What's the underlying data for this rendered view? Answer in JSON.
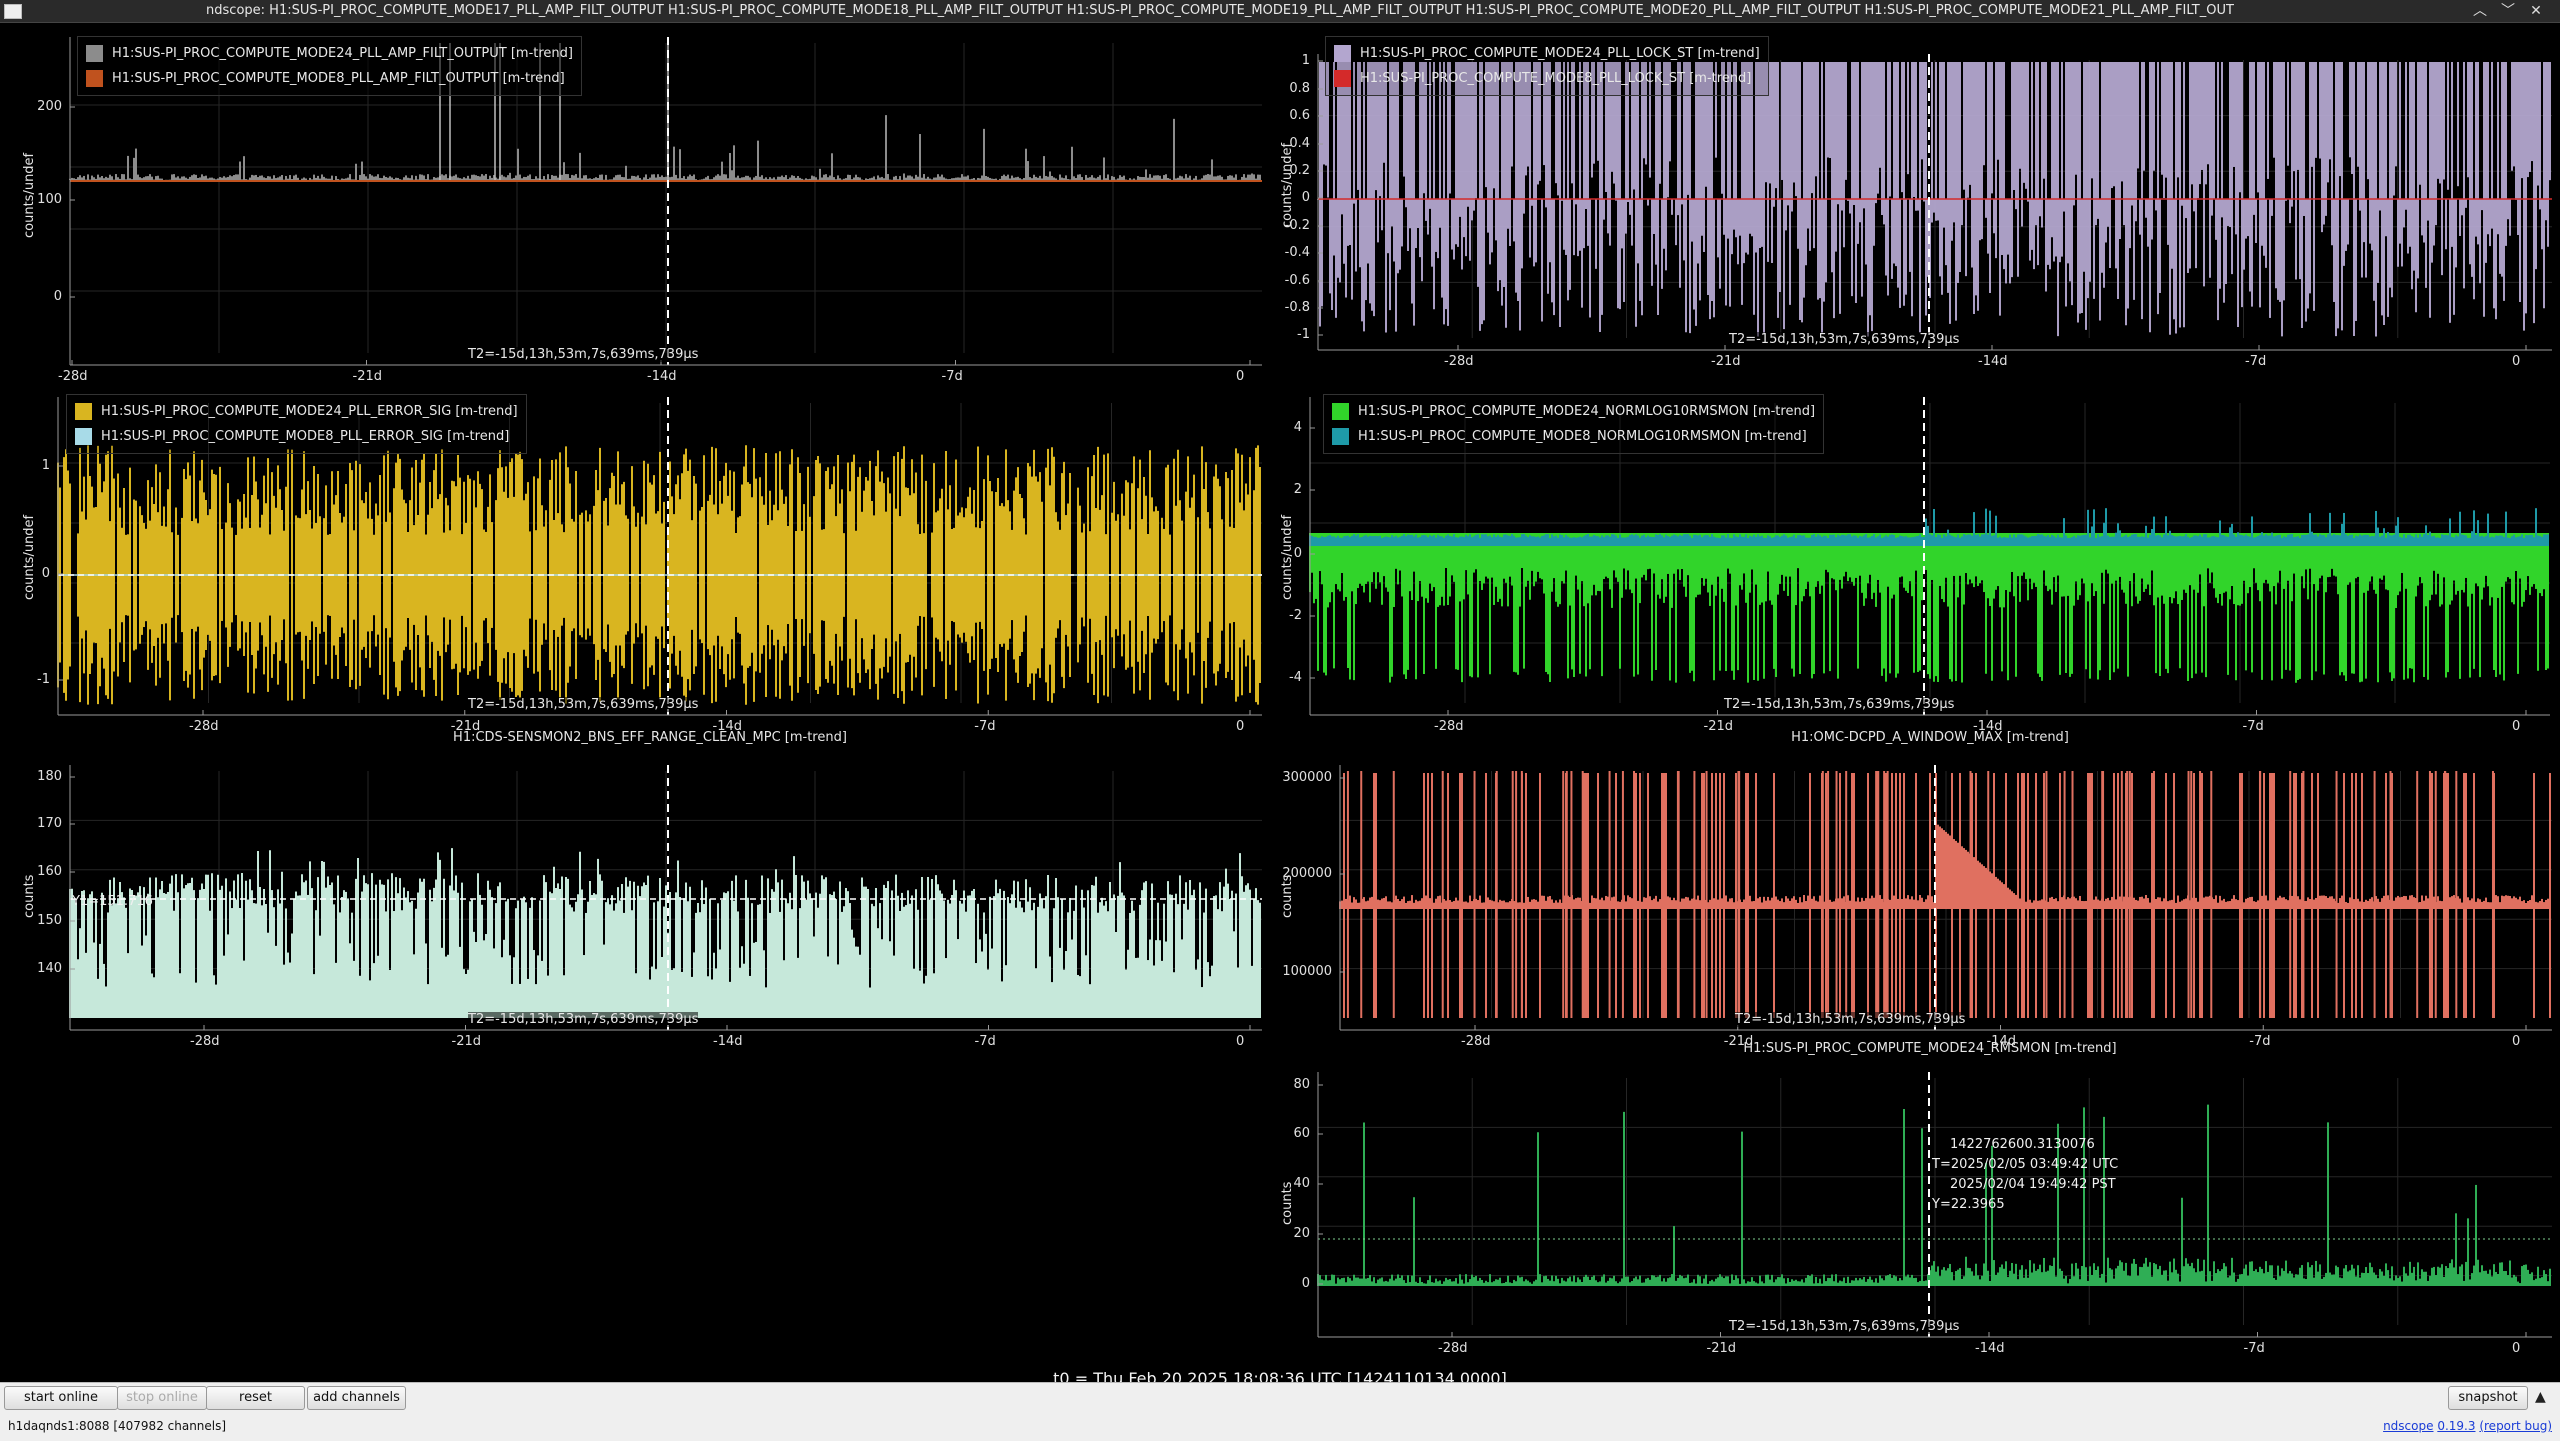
{
  "window": {
    "title": "ndscope: H1:SUS-PI_PROC_COMPUTE_MODE17_PLL_AMP_FILT_OUTPUT H1:SUS-PI_PROC_COMPUTE_MODE18_PLL_AMP_FILT_OUTPUT H1:SUS-PI_PROC_COMPUTE_MODE19_PLL_AMP_FILT_OUTPUT H1:SUS-PI_PROC_COMPUTE_MODE20_PLL_AMP_FILT_OUTPUT H1:SUS-PI_PROC_COMPUTE_MODE21_PLL_AMP_FILT_OUT",
    "minimize_icon": "chevron-up-icon",
    "maximize_icon": "chevron-down-icon",
    "close_icon": "close-icon"
  },
  "x_axis": {
    "ticks": [
      "-28d",
      "-21d",
      "-14d",
      "-7d",
      "0"
    ]
  },
  "cursor_label": "T2=-15d,13h,53m,7s,639ms,739µs",
  "panels": [
    {
      "id": "p1",
      "ylabel": "counts/undef",
      "yticks": [
        "200",
        "100",
        "0"
      ],
      "legend": [
        {
          "label": "H1:SUS-PI_PROC_COMPUTE_MODE24_PLL_AMP_FILT_OUTPUT [m-trend]",
          "color": "#8c8c8c"
        },
        {
          "label": "H1:SUS-PI_PROC_COMPUTE_MODE8_PLL_AMP_FILT_OUTPUT [m-trend]",
          "color": "#c0521e"
        }
      ]
    },
    {
      "id": "p2",
      "ylabel": "counts/undef",
      "yticks": [
        "1",
        "0.8",
        "0.6",
        "0.4",
        "0.2",
        "0",
        "-0.2",
        "-0.4",
        "-0.6",
        "-0.8",
        "-1"
      ],
      "legend": [
        {
          "label": "H1:SUS-PI_PROC_COMPUTE_MODE24_PLL_LOCK_ST [m-trend]",
          "color": "#b3a6cf"
        },
        {
          "label": "H1:SUS-PI_PROC_COMPUTE_MODE8_PLL_LOCK_ST [m-trend]",
          "color": "#d42a2a"
        }
      ]
    },
    {
      "id": "p3",
      "ylabel": "counts/undef",
      "yticks": [
        "1",
        "0",
        "-1"
      ],
      "legend": [
        {
          "label": "H1:SUS-PI_PROC_COMPUTE_MODE24_PLL_ERROR_SIG [m-trend]",
          "color": "#d9b520"
        },
        {
          "label": "H1:SUS-PI_PROC_COMPUTE_MODE8_PLL_ERROR_SIG [m-trend]",
          "color": "#a8dbe8"
        }
      ]
    },
    {
      "id": "p4",
      "ylabel": "counts/undef",
      "yticks": [
        "4",
        "2",
        "0",
        "-2",
        "-4"
      ],
      "legend": [
        {
          "label": "H1:SUS-PI_PROC_COMPUTE_MODE24_NORMLOG10RMSMON [m-trend]",
          "color": "#31d42a"
        },
        {
          "label": "H1:SUS-PI_PROC_COMPUTE_MODE8_NORMLOG10RMSMON [m-trend]",
          "color": "#1e9aa8"
        }
      ]
    },
    {
      "id": "p5",
      "title": "H1:CDS-SENSMON2_BNS_EFF_RANGE_CLEAN_MPC [m-trend]",
      "ylabel": "counts",
      "yticks": [
        "180",
        "170",
        "160",
        "150",
        "140"
      ],
      "y1": "Y1=151.716",
      "color": "#c6e8da"
    },
    {
      "id": "p6",
      "title": "H1:OMC-DCPD_A_WINDOW_MAX [m-trend]",
      "ylabel": "counts",
      "yticks": [
        "300000",
        "200000",
        "100000"
      ],
      "color": "#e07060"
    },
    {
      "id": "p7",
      "title": "H1:SUS-PI_PROC_COMPUTE_MODE24_RMSMON [m-trend]",
      "ylabel": "counts",
      "yticks": [
        "80",
        "60",
        "40",
        "20",
        "0"
      ],
      "color": "#2fae55",
      "cursor_info": [
        "1422762600.3130076",
        "T=2025/02/05 03:49:42 UTC",
        "2025/02/04 19:49:42 PST",
        "Y=22.3965"
      ]
    }
  ],
  "t0": "t0 = Thu Feb 20 2025 18:08:36 UTC [1424110134.0000]",
  "toolbar": {
    "start_online": "start online",
    "stop_online": "stop online",
    "reset": "reset",
    "add_channels": "add channels",
    "snapshot": "snapshot"
  },
  "status": {
    "server": "h1daqnds1:8088  [407982 channels]",
    "app": "ndscope",
    "version": "0.19.3",
    "report": "(report bug)"
  }
}
